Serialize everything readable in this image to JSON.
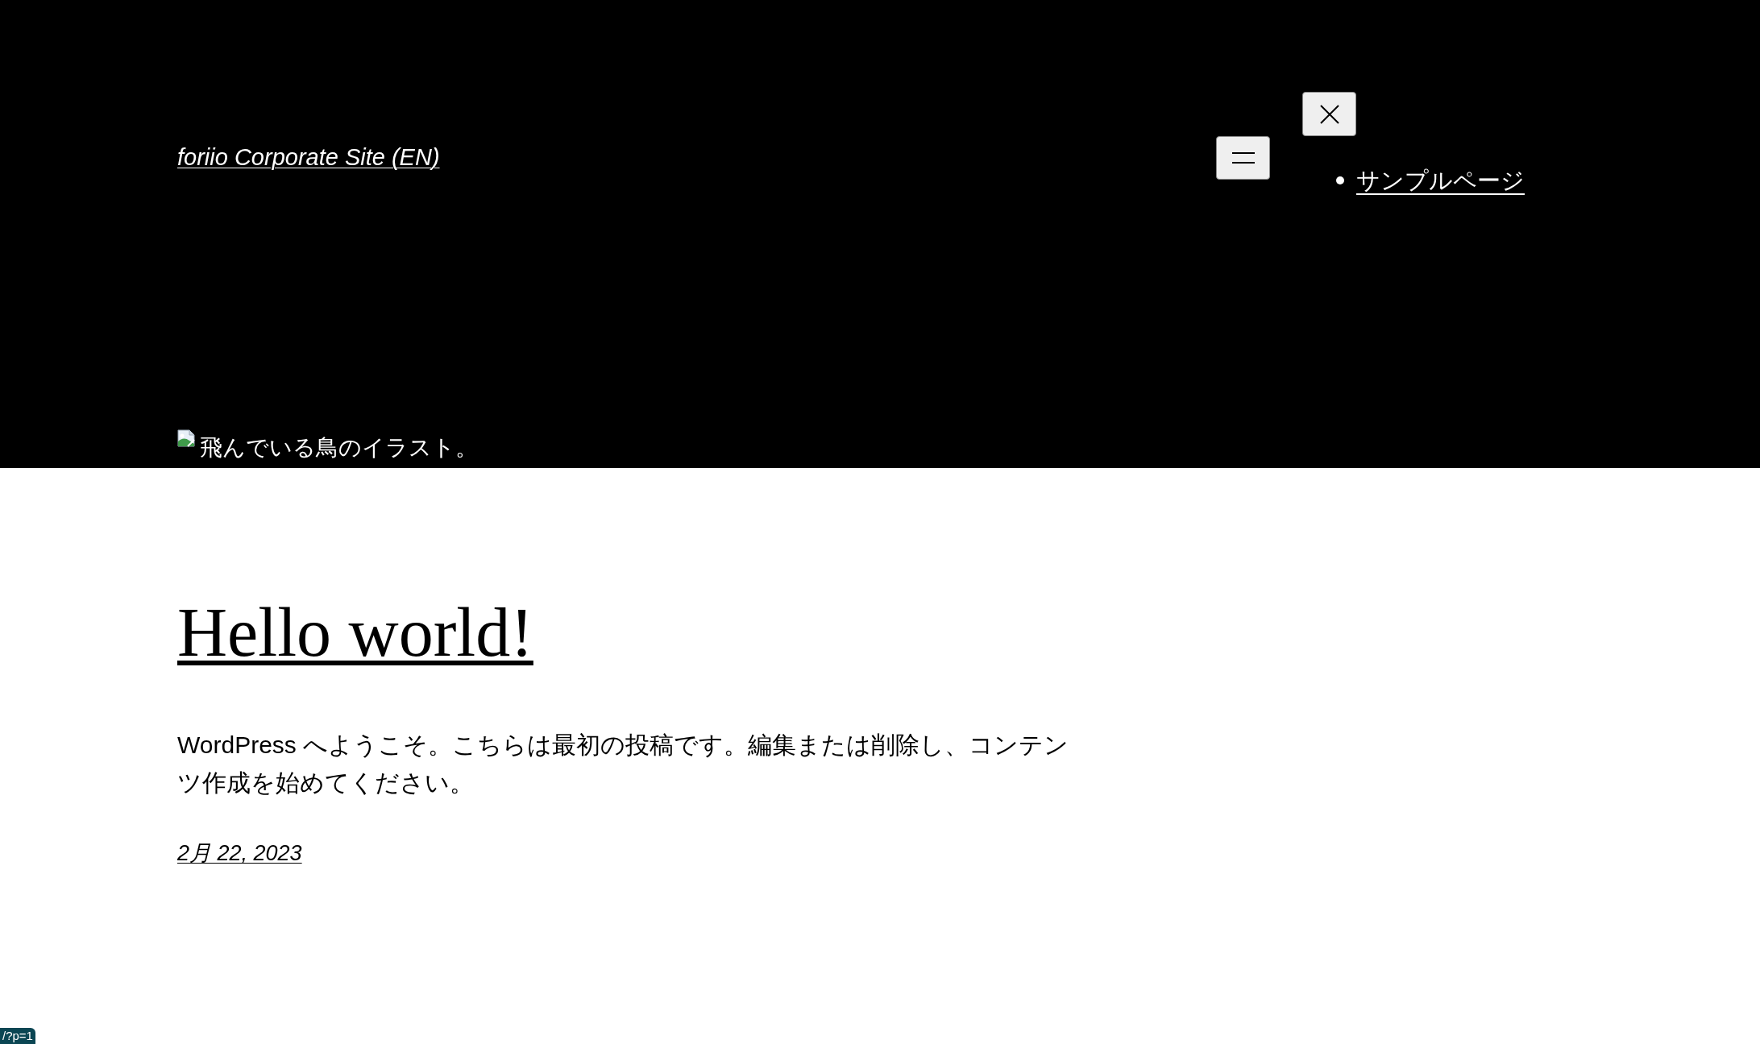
{
  "header": {
    "site_title": "foriio Corporate Site (EN)",
    "nav": {
      "items": [
        {
          "label": "サンプルページ"
        }
      ]
    },
    "header_image": {
      "alt": "飛んでいる鳥のイラスト。"
    }
  },
  "post": {
    "title": "Hello world!",
    "body": "WordPress へようこそ。こちらは最初の投稿です。編集または削除し、コンテンツ作成を始めてください。",
    "date": "2月 22, 2023"
  },
  "status_link": "/?p=1"
}
